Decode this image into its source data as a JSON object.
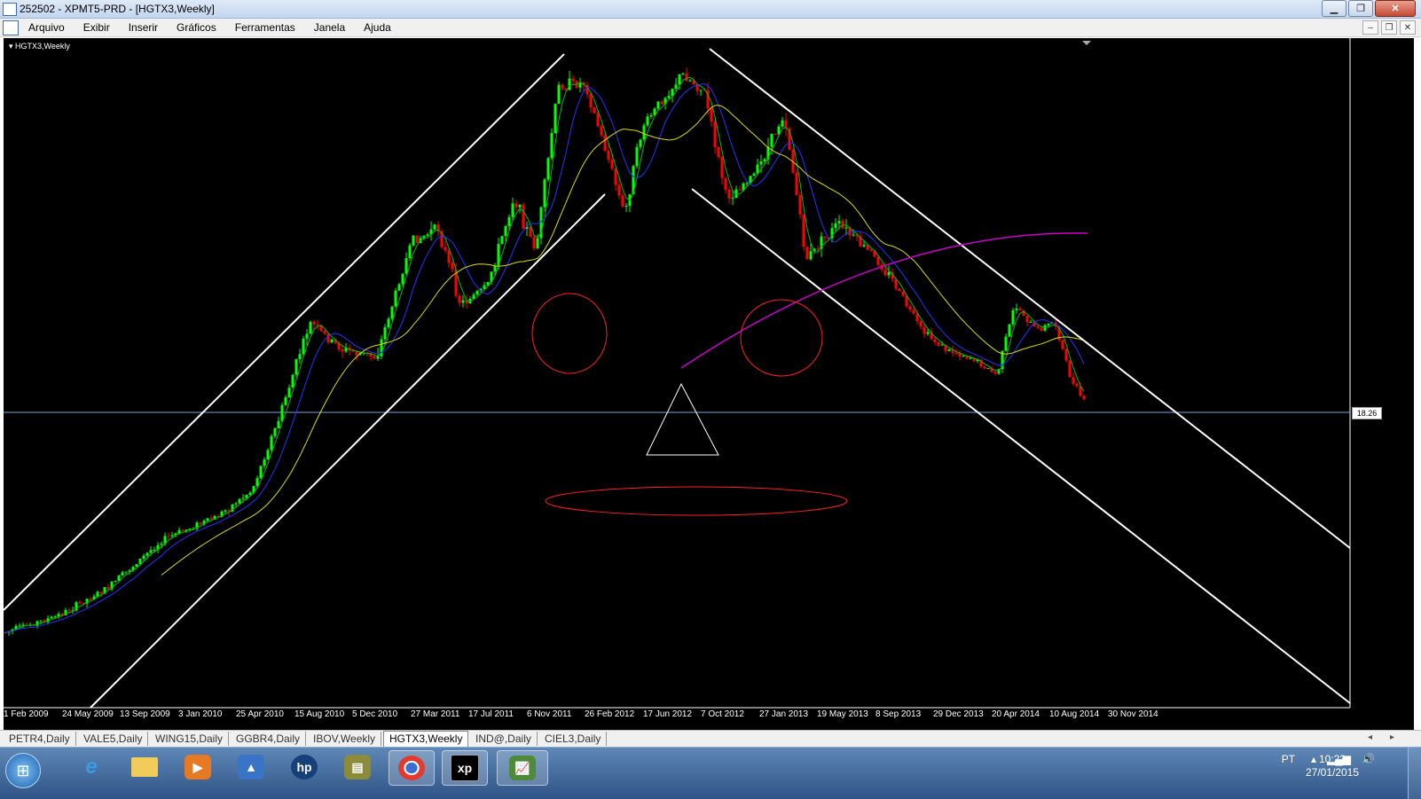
{
  "window": {
    "title": "252502 - XPMT5-PRD - [HGTX3,Weekly]"
  },
  "menu": [
    "Arquivo",
    "Exibir",
    "Inserir",
    "Gráficos",
    "Ferramentas",
    "Janela",
    "Ajuda"
  ],
  "chart": {
    "label": "HGTX3,Weekly",
    "current_price": "18.26",
    "x_ticks": [
      "1 Feb 2009",
      "24 May 2009",
      "13 Sep 2009",
      "3 Jan 2010",
      "25 Apr 2010",
      "15 Aug 2010",
      "5 Dec 2010",
      "27 Mar 2011",
      "17 Jul 2011",
      "6 Nov 2011",
      "26 Feb 2012",
      "17 Jun 2012",
      "7 Oct 2012",
      "27 Jan 2013",
      "19 May 2013",
      "8 Sep 2013",
      "29 Dec 2013",
      "20 Apr 2014",
      "10 Aug 2014",
      "30 Nov 2014"
    ],
    "colors": {
      "bull": "#00ff00",
      "bear": "#ff0000",
      "ma_fast": "#00c000",
      "ma_mid": "#2233ff",
      "ma_slow": "#dddd00",
      "arc": "#cc00cc",
      "drawing": "#ffffff",
      "face": "#ff2020"
    }
  },
  "tabs": [
    "PETR4,Daily",
    "VALE5,Daily",
    "WING15,Daily",
    "GGBR4,Daily",
    "IBOV,Weekly",
    "HGTX3,Weekly",
    "IND@,Daily",
    "CIEL3,Daily"
  ],
  "active_tab": "HGTX3,Weekly",
  "taskbar": {
    "apps": [
      "internet-explorer",
      "file-explorer",
      "media-player",
      "network-app",
      "hp-app",
      "archive-app",
      "chrome",
      "xp-investimentos",
      "metatrader"
    ],
    "language": "PT",
    "time": "10:23",
    "date": "27/01/2015"
  }
}
